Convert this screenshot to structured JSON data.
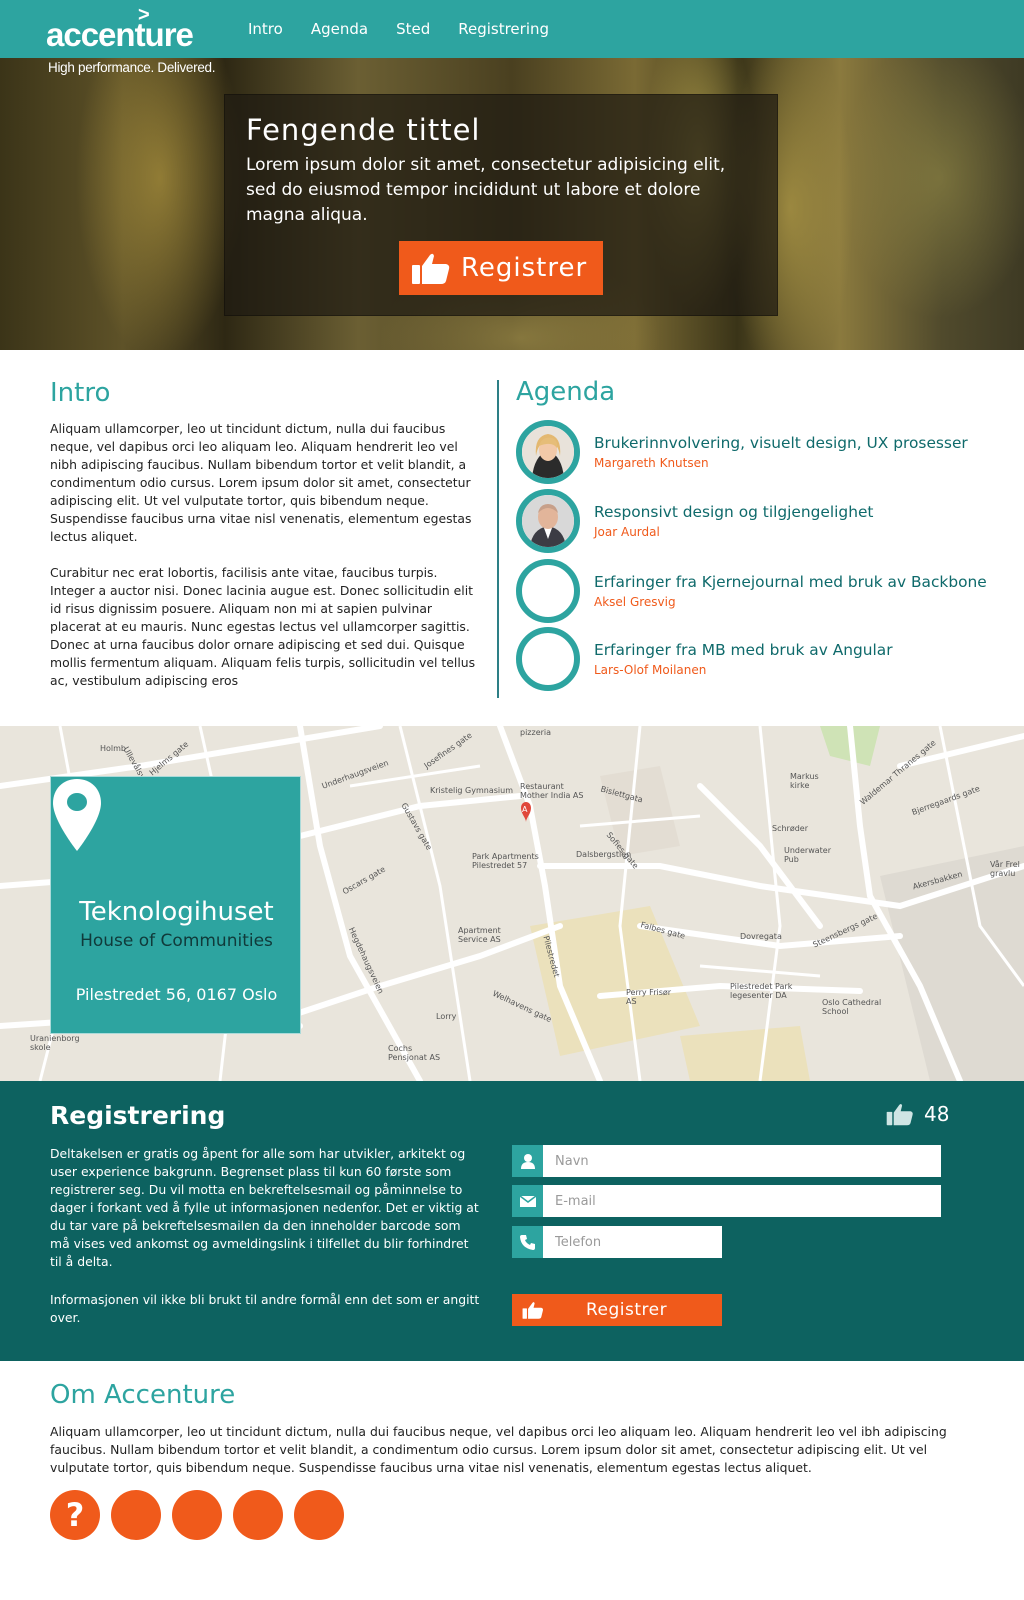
{
  "brand": {
    "logo_text": "accenture",
    "tagline": "High performance. Delivered.",
    "primary_color": "#2da4a0",
    "dark_color": "#0d6260",
    "accent_color": "#f05a1b"
  },
  "nav": {
    "items": [
      {
        "label": "Intro"
      },
      {
        "label": "Agenda"
      },
      {
        "label": "Sted"
      },
      {
        "label": "Registrering"
      }
    ]
  },
  "hero": {
    "title": "Fengende tittel",
    "text": "Lorem ipsum dolor sit amet, consectetur adipisicing elit, sed do eiusmod tempor incididunt ut labore et dolore magna aliqua.",
    "button_label": "Registrer"
  },
  "intro": {
    "title": "Intro",
    "paragraph1": "Aliquam ullamcorper, leo ut tincidunt dictum, nulla dui faucibus neque, vel dapibus orci leo aliquam leo. Aliquam hendrerit leo vel nibh adipiscing faucibus. Nullam bibendum tortor et velit blandit, a condimentum odio cursus. Lorem ipsum dolor sit amet, consectetur adipiscing elit. Ut vel vulputate tortor, quis bibendum neque. Suspendisse faucibus urna vitae nisl venenatis, elementum egestas lectus aliquet.",
    "paragraph2": "Curabitur nec erat lobortis, facilisis ante vitae, faucibus turpis. Integer a auctor nisi. Donec lacinia augue est. Donec sollicitudin elit id risus dignissim posuere. Aliquam non mi at sapien pulvinar placerat at eu mauris. Nunc egestas lectus vel ullamcorper sagittis. Donec at urna faucibus dolor ornare adipiscing et sed dui. Quisque mollis fermentum aliquam. Aliquam felis turpis, sollicitudin vel tellus ac, vestibulum adipiscing eros"
  },
  "agenda": {
    "title": "Agenda",
    "items": [
      {
        "talk": "Brukerinnvolvering, visuelt design, UX prosesser",
        "speaker": "Margareth Knutsen",
        "has_photo": true
      },
      {
        "talk": "Responsivt design og tilgjengelighet",
        "speaker": "Joar Aurdal",
        "has_photo": true
      },
      {
        "talk": "Erfaringer fra Kjernejournal med bruk av Backbone",
        "speaker": "Aksel Gresvig",
        "has_photo": false
      },
      {
        "talk": "Erfaringer fra MB med bruk av Angular",
        "speaker": "Lars-Olof Moilanen",
        "has_photo": false
      }
    ]
  },
  "location": {
    "name": "Teknologihuset",
    "subtitle": "House of Communities",
    "address": "Pilestredet 56, 0167 Oslo",
    "pin_icon": "map-pin-icon"
  },
  "map": {
    "labels": [
      "Holmb",
      "Ullevålsveien",
      "Hjelms gate",
      "pizzeria",
      "Underhaugsveien",
      "Josefines gate",
      "Kristelig Gymnasium",
      "Restaurant Mother India AS",
      "Bislettgata",
      "Sofies gate",
      "Markus kirke",
      "Waldemar Thranes gate",
      "Bjerregaards gate",
      "Schrøder",
      "Underwater Pub",
      "Park Apartments Pilestredet 57",
      "Dalsbergstien",
      "Oscars gate",
      "Gustavs gate",
      "Apartment Service AS",
      "Falbes gate",
      "Dovregata",
      "Akersbakken",
      "Steensbergs gate",
      "Perry Frisør AS",
      "Pilestredet Park legesenter DA",
      "Oslo Cathedral School",
      "Hegdehaugsveien",
      "Welhavens gate",
      "Cochs Pensjonat AS",
      "Uranienborg skole",
      "Lorry",
      "Pilestredet",
      "Vår Frel gravlu"
    ]
  },
  "registration": {
    "title": "Registrering",
    "like_count": "48",
    "paragraph1": "Deltakelsen er gratis og åpent for alle som har utvikler, arkitekt og user experience bakgrunn. Begrenset plass til kun 60 første som registrerer seg. Du vil motta en bekreftelsesmail og påminnelse to dager i forkant ved å fylle ut informasjonen nedenfor. Det er viktig at du tar vare på bekreftelsesmailen da den inneholder barcode som må vises ved ankomst og avmeldingslink i tilfellet du blir forhindret til å delta.",
    "paragraph2": "Informasjonen vil ikke bli brukt til andre formål enn det som er angitt over.",
    "fields": {
      "name_placeholder": "Navn",
      "email_placeholder": "E-mail",
      "phone_placeholder": "Telefon"
    },
    "button_label": "Registrer"
  },
  "about": {
    "title": "Om Accenture",
    "text": "Aliquam ullamcorper, leo ut tincidunt dictum, nulla dui faucibus neque, vel dapibus orci leo aliquam leo. Aliquam hendrerit leo vel ibh adipiscing faucibus. Nullam bibendum tortor et velit blandit, a condimentum odio cursus. Lorem ipsum dolor sit amet, consectetur adipiscing elit. Ut vel vulputate tortor, quis bibendum neque. Suspendisse faucibus urna vitae nisl venenatis, elementum egestas lectus aliquet.",
    "social": [
      {
        "icon": "question-icon",
        "glyph": "?"
      },
      {
        "icon": "social-icon-2",
        "glyph": ""
      },
      {
        "icon": "social-icon-3",
        "glyph": ""
      },
      {
        "icon": "social-icon-4",
        "glyph": ""
      },
      {
        "icon": "social-icon-5",
        "glyph": ""
      }
    ]
  }
}
